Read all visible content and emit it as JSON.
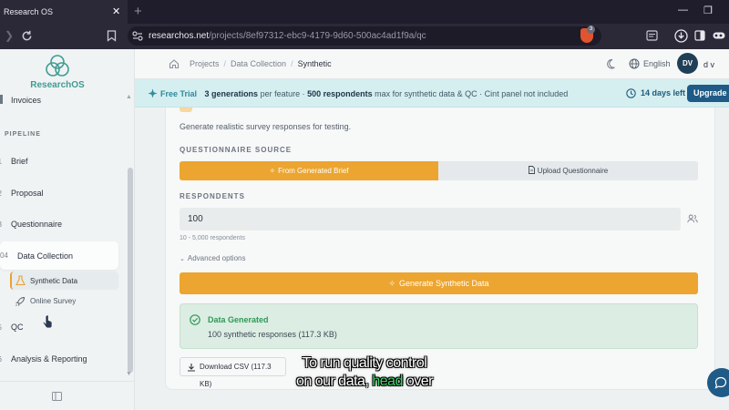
{
  "browser": {
    "tab_title": "Research OS",
    "tab_close": "✕",
    "new_tab": "+",
    "url_host": "researchos.net",
    "url_path": "/projects/8ef97312-ebc9-4179-9d60-500ac4ad1f9a/qc",
    "shield_badge": "3"
  },
  "header": {
    "breadcrumb": [
      "Projects",
      "Data Collection",
      "Synthetic"
    ],
    "language": "English",
    "avatar_initials": "DV",
    "user_name": "d v"
  },
  "sidebar": {
    "logo_text": "ResearchOS",
    "invoices": "Invoices",
    "pipeline_label": "PIPELINE",
    "items": [
      {
        "num": "01",
        "label": "Brief"
      },
      {
        "num": "02",
        "label": "Proposal"
      },
      {
        "num": "03",
        "label": "Questionnaire"
      },
      {
        "num": "04",
        "label": "Data Collection"
      },
      {
        "num": "05",
        "label": "QC"
      },
      {
        "num": "06",
        "label": "Analysis & Reporting"
      }
    ],
    "sub_items": [
      "Synthetic Data",
      "Online Survey"
    ]
  },
  "banner": {
    "free_trial": "Free Trial",
    "generations": "3 generations",
    "per_feature": " per feature · ",
    "respondents": "500 respondents",
    "rest": " max for synthetic data & QC · Cint panel not included",
    "days_left": "14 days left",
    "upgrade": "Upgrade"
  },
  "main": {
    "description": "Generate realistic survey responses for testing.",
    "questionnaire_source_label": "QUESTIONNAIRE SOURCE",
    "from_brief": "From Generated Brief",
    "upload_questionnaire": "Upload Questionnaire",
    "respondents_label": "RESPONDENTS",
    "respondents_value": "100",
    "respondents_hint": "10 - 5,000 respondents",
    "advanced_options": "Advanced options",
    "generate_button": "Generate Synthetic Data",
    "success_title": "Data Generated",
    "success_detail": "100 synthetic responses (117.3 KB)",
    "download_button": "Download CSV (117.3 KB)"
  },
  "caption": {
    "line1": "To run quality control",
    "line2_a": "on our data, ",
    "line2_highlight": "head",
    "line2_b": " over"
  },
  "colors": {
    "accent_orange": "#eca530",
    "brand_teal": "#3e9c94",
    "upgrade_blue": "#1f5b86",
    "success_green": "#2e9958"
  }
}
